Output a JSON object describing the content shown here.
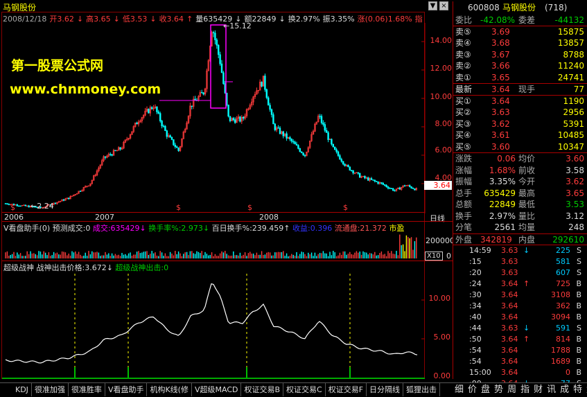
{
  "app": {
    "title": "马钢股份"
  },
  "window_buttons": [
    "▼",
    "×"
  ],
  "infobar": {
    "date": "2008/12/18",
    "open": "开3.62",
    "open_arrow": "↓",
    "high": "高3.65",
    "high_arrow": "↓",
    "low": "低3.53",
    "low_arrow": "↓",
    "close": "收3.64",
    "close_arrow": "↑",
    "volume": "量635429",
    "volume_arrow": "↓",
    "amount": "额22849",
    "amount_arrow": "↓",
    "turnover": "换2.97%",
    "amplitude": "振3.35%",
    "change": "涨(0.06)1.68%",
    "index": "指数(38.8"
  },
  "watermark": {
    "line1": "第一股票公式网",
    "line2": "www.chnmoney.com"
  },
  "price_chart": {
    "yaxis": [
      "14.00",
      "12.00",
      "10.00",
      "8.00",
      "6.00",
      "4.00"
    ],
    "current_price": "3.64",
    "max_label": "15.12",
    "min_label": "2.24",
    "dates": [
      "2006",
      "2007",
      "2008"
    ],
    "period": "日线",
    "signal_marks": [
      "$",
      "$",
      "$",
      "$"
    ]
  },
  "volume_panel": {
    "label": "V看盘助手(0)",
    "predict": "预测成交:0",
    "deal": "成交:635429",
    "deal_arrow": "↓",
    "turnover_rate": "换手率%:2.973",
    "turnover_arrow": "↓",
    "hundred_day": "百日换手%:239.459",
    "hundred_arrow": "↑",
    "income": "收益:0.396",
    "float": "流通盘:21.372",
    "market_pe": "市盈",
    "yaxis": "200000",
    "unit": "X10",
    "zero": "0"
  },
  "god_panel": {
    "label": "超级战神",
    "price_label": "战神出击价格:3.672",
    "price_arrow": "↓",
    "signal_label": "超级战神出击:0",
    "yaxis": [
      "10.00",
      "5.00",
      "0.00"
    ]
  },
  "tabs": [
    "KDJ",
    "很准加强",
    "很准胜率",
    "V看盘助手",
    "机构K线(修",
    "V超级MACD",
    "权证交易B",
    "权证交易C",
    "权证交易F",
    "日分隔线",
    "狐狸出击"
  ],
  "right": {
    "code": "600808",
    "name": "马钢股份",
    "count": "(718)",
    "weibi_label": "委比",
    "weibi": "-42.08%",
    "weicha_label": "委差",
    "weicha": "-44132",
    "sells": [
      {
        "label": "卖⑤",
        "price": "3.69",
        "vol": "15875"
      },
      {
        "label": "卖④",
        "price": "3.68",
        "vol": "13857"
      },
      {
        "label": "卖③",
        "price": "3.67",
        "vol": "8788"
      },
      {
        "label": "卖②",
        "price": "3.66",
        "vol": "11240"
      },
      {
        "label": "卖①",
        "price": "3.65",
        "vol": "24741"
      }
    ],
    "latest_label": "最新",
    "latest": "3.64",
    "xianshou_label": "现手",
    "xianshou": "77",
    "buys": [
      {
        "label": "买①",
        "price": "3.64",
        "vol": "1190"
      },
      {
        "label": "买②",
        "price": "3.63",
        "vol": "2956"
      },
      {
        "label": "买③",
        "price": "3.62",
        "vol": "5391"
      },
      {
        "label": "买④",
        "price": "3.61",
        "vol": "10485"
      },
      {
        "label": "买⑤",
        "price": "3.60",
        "vol": "10347"
      }
    ],
    "stats": [
      {
        "l1": "涨跌",
        "v1": "0.06",
        "l2": "均价",
        "v2": "3.60"
      },
      {
        "l1": "涨幅",
        "v1": "1.68%",
        "l2": "前收",
        "v2": "3.58"
      },
      {
        "l1": "振幅",
        "v1": "3.35%",
        "l2": "今开",
        "v2": "3.62"
      },
      {
        "l1": "总手",
        "v1": "635429",
        "l2": "最高",
        "v2": "3.65"
      },
      {
        "l1": "总额",
        "v1": "22849",
        "l2": "最低",
        "v2": "3.53"
      },
      {
        "l1": "换手",
        "v1": "2.97%",
        "l2": "量比",
        "v2": "3.12"
      },
      {
        "l1": "分笔",
        "v1": "2561",
        "l2": "均量",
        "v2": "248"
      }
    ],
    "waipan_label": "外盘",
    "waipan": "342819",
    "neipan_label": "内盘",
    "neipan": "292610",
    "ticks": [
      {
        "t": "14:59",
        "p": "3.63",
        "a": "↓",
        "v": "225",
        "s": "S"
      },
      {
        "t": ":15",
        "p": "3.63",
        "a": "",
        "v": "581",
        "s": "S"
      },
      {
        "t": ":20",
        "p": "3.63",
        "a": "",
        "v": "607",
        "s": "S"
      },
      {
        "t": ":24",
        "p": "3.64",
        "a": "↑",
        "v": "725",
        "s": "B"
      },
      {
        "t": ":30",
        "p": "3.64",
        "a": "",
        "v": "3108",
        "s": "B"
      },
      {
        "t": ":34",
        "p": "3.64",
        "a": "",
        "v": "362",
        "s": "B"
      },
      {
        "t": ":40",
        "p": "3.64",
        "a": "",
        "v": "3094",
        "s": "B"
      },
      {
        "t": ":44",
        "p": "3.63",
        "a": "↓",
        "v": "591",
        "s": "S"
      },
      {
        "t": ":50",
        "p": "3.64",
        "a": "↑",
        "v": "814",
        "s": "B"
      },
      {
        "t": ":54",
        "p": "3.64",
        "a": "",
        "v": "1788",
        "s": "B"
      },
      {
        "t": ":54",
        "p": "3.64",
        "a": "",
        "v": "1689",
        "s": "B"
      },
      {
        "t": "15:00",
        "p": "3.64",
        "a": "",
        "v": "0",
        "s": "B"
      },
      {
        "t": ":00",
        "p": "3.64",
        "a": "↓",
        "v": "77",
        "s": "S"
      }
    ],
    "bottom_tabs": [
      "细",
      "价",
      "盘",
      "势",
      "周",
      "指",
      "财",
      "讯",
      "成",
      "特",
      "解"
    ]
  }
}
